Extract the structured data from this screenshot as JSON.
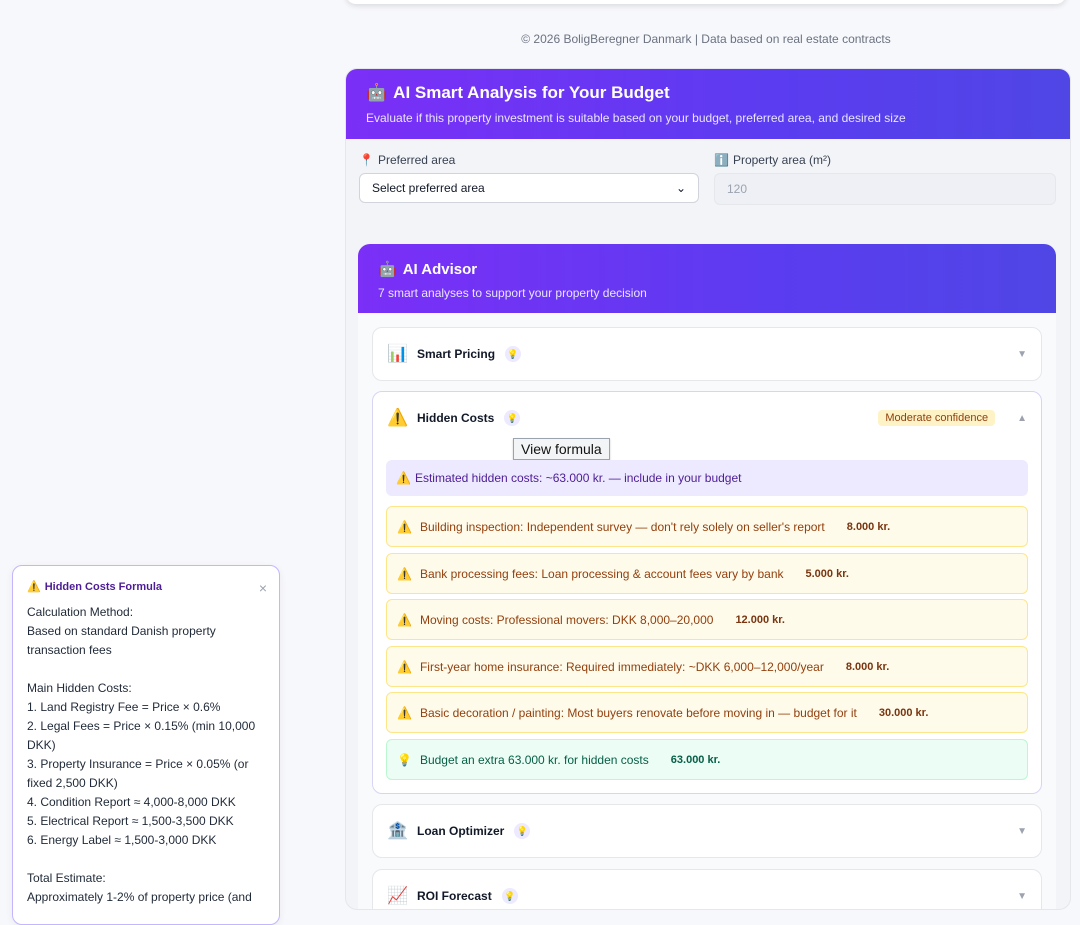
{
  "footer": "© 2026 BoligBeregner Danmark | Data based on real estate contracts",
  "panel": {
    "title": "AI Smart Analysis for Your Budget",
    "subtitle": "Evaluate if this property investment is suitable based on your budget, preferred area, and desired size",
    "area_label": "Preferred area",
    "area_value": "Select preferred area",
    "size_label": "Property area (m²)",
    "size_placeholder": "120"
  },
  "advisor": {
    "title": "AI Advisor",
    "subtitle": "7 smart analyses to support your property decision",
    "sections": {
      "pricing": "Smart Pricing",
      "hidden": "Hidden Costs",
      "loan": "Loan Optimizer",
      "roi": "ROI Forecast"
    },
    "confidence": "Moderate confidence",
    "tooltip": "View formula",
    "summary": "Estimated hidden costs: ~63.000 kr. — include in your budget",
    "items": [
      {
        "text": "Building inspection: Independent survey — don't rely solely on seller's report",
        "amount": "8.000 kr."
      },
      {
        "text": "Bank processing fees: Loan processing & account fees vary by bank",
        "amount": "5.000 kr."
      },
      {
        "text": "Moving costs: Professional movers: DKK 8,000–20,000",
        "amount": "12.000 kr."
      },
      {
        "text": "First-year home insurance: Required immediately: ~DKK 6,000–12,000/year",
        "amount": "8.000 kr."
      },
      {
        "text": "Basic decoration / painting: Most buyers renovate before moving in — budget for it",
        "amount": "30.000 kr."
      }
    ],
    "tip": {
      "text": "Budget an extra 63.000 kr. for hidden costs",
      "amount": "63.000 kr."
    }
  },
  "formula": {
    "title": "Hidden Costs Formula",
    "method_label": "Calculation Method:",
    "method_1": "Based on standard Danish property",
    "method_2": "transaction fees",
    "main_label": "Main Hidden Costs:",
    "l1": "1. Land Registry Fee = Price × 0.6%",
    "l2a": "2. Legal Fees = Price × 0.15% (min 10,000",
    "l2b": "DKK)",
    "l3a": "3. Property Insurance = Price × 0.05% (or",
    "l3b": "fixed 2,500 DKK)",
    "l4": "4. Condition Report ≈ 4,000-8,000 DKK",
    "l5": "5. Electrical Report ≈ 1,500-3,500 DKK",
    "l6": "6. Energy Label ≈ 1,500-3,000 DKK",
    "total_label": "Total Estimate:",
    "total_text": "Approximately 1-2% of property price (and"
  }
}
